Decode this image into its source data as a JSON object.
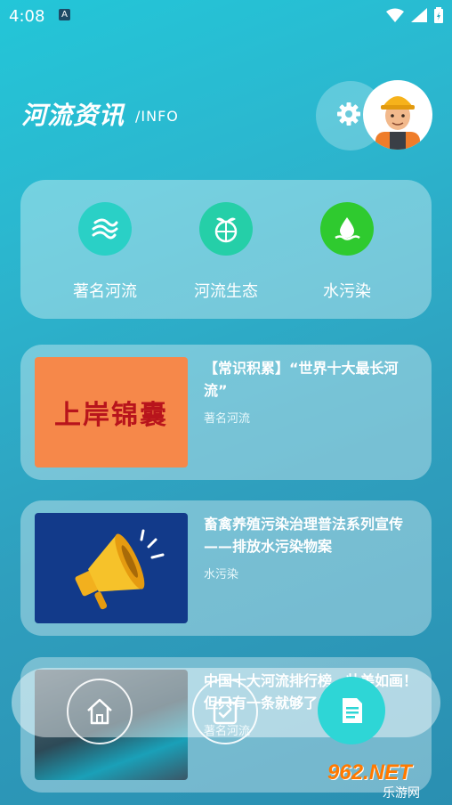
{
  "status_bar": {
    "time": "4:08",
    "notification_icon": "A"
  },
  "header": {
    "title": "河流资讯",
    "subtitle": "/INFO"
  },
  "categories": [
    {
      "label": "著名河流",
      "icon": "river-waves-icon",
      "color": "#2ad0c6"
    },
    {
      "label": "河流生态",
      "icon": "globe-leaf-icon",
      "color": "#25cfa8"
    },
    {
      "label": "水污染",
      "icon": "water-drop-icon",
      "color": "#2fca2f"
    }
  ],
  "news": [
    {
      "title": "【常识积累】“世界十大最长河流”",
      "tag": "著名河流",
      "thumb_text": "上岸锦囊"
    },
    {
      "title": "畜禽养殖污染治理普法系列宣传——排放水污染物案",
      "tag": "水污染"
    },
    {
      "title": "中国十大河流排行榜，壮美如画！但只有一条就够了！",
      "tag": "著名河流"
    }
  ],
  "bottom_nav": {
    "items": [
      "home-icon",
      "calendar-check-icon",
      "document-icon"
    ]
  },
  "watermark": {
    "logo": "962.NET",
    "name": "乐游网"
  }
}
